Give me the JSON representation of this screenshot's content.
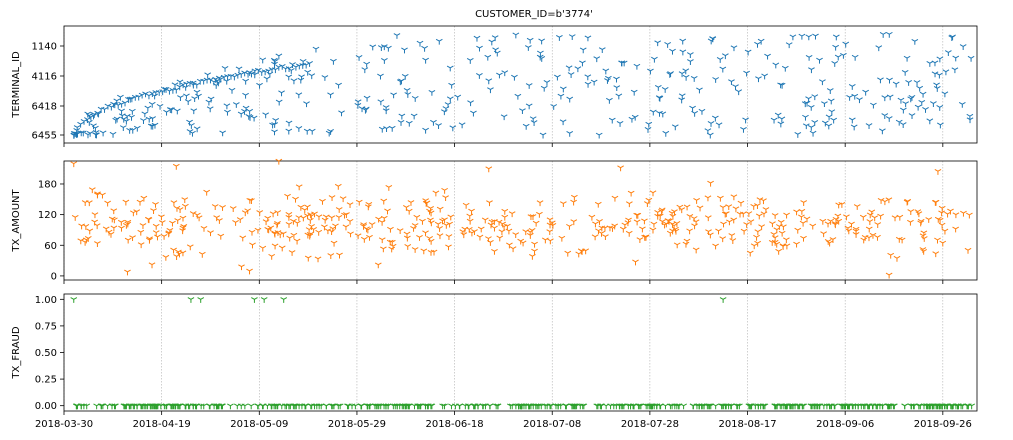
{
  "figure": {
    "title": "CUSTOMER_ID=b'3774'"
  },
  "x_axis": {
    "ticks": [
      "2018-03-30",
      "2018-04-19",
      "2018-05-09",
      "2018-05-29",
      "2018-06-18",
      "2018-07-08",
      "2018-07-28",
      "2018-08-17",
      "2018-09-06",
      "2018-09-26"
    ],
    "range": [
      "2018-03-30",
      "2018-10-03"
    ]
  },
  "colors": {
    "terminal": "#1f77b4",
    "amount": "#ff7f0e",
    "fraud": "#2ca02c",
    "grid": "#b0b0b0"
  },
  "chart_data": [
    {
      "type": "scatter",
      "marker": "tri-down",
      "ylabel": "TERMINAL_ID",
      "categorical_y": true,
      "y_tick_labels": [
        "1140",
        "4116",
        "6418",
        "6455"
      ],
      "grid": "x-only dotted",
      "points_sample": [
        {
          "x": "2018-04-01",
          "y": "6455"
        },
        {
          "x": "2018-04-06",
          "y": "6418"
        },
        {
          "x": "2018-04-12",
          "y": "4116"
        },
        {
          "x": "2018-04-24",
          "y": "4116"
        },
        {
          "x": "2018-05-10",
          "y": "1140"
        },
        {
          "x": "2018-06-03",
          "y": "1140"
        },
        {
          "x": "2018-06-28",
          "y": "6418"
        },
        {
          "x": "2018-07-19",
          "y": "1140"
        },
        {
          "x": "2018-08-05",
          "y": "1140"
        },
        {
          "x": "2018-09-02",
          "y": "1140"
        },
        {
          "x": "2018-09-30",
          "y": "6418"
        }
      ]
    },
    {
      "type": "scatter",
      "marker": "tri-down",
      "ylabel": "TX_AMOUNT",
      "y_ticks": [
        0,
        60,
        120,
        180
      ],
      "ylim": [
        -8,
        225
      ],
      "grid": "x-only dotted",
      "points_sample": [
        {
          "x": "2018-04-01",
          "y": 220
        },
        {
          "x": "2018-04-22",
          "y": 215
        },
        {
          "x": "2018-05-13",
          "y": 225
        },
        {
          "x": "2018-06-25",
          "y": 210
        },
        {
          "x": "2018-07-22",
          "y": 212
        },
        {
          "x": "2018-09-25",
          "y": 205
        },
        {
          "x": "2018-04-12",
          "y": 8
        },
        {
          "x": "2018-05-07",
          "y": 10
        },
        {
          "x": "2018-09-15",
          "y": 2
        }
      ]
    },
    {
      "type": "scatter",
      "marker": "tri-down",
      "ylabel": "TX_FRAUD",
      "y_ticks": [
        0.0,
        0.25,
        0.5,
        0.75,
        1.0
      ],
      "y_tick_labels": [
        "0.00",
        "0.25",
        "0.50",
        "0.75",
        "1.00"
      ],
      "ylim": [
        -0.05,
        1.05
      ],
      "grid": "x-only dotted",
      "fraud_points": [
        {
          "x": "2018-04-01",
          "y": 1
        },
        {
          "x": "2018-04-25",
          "y": 1
        },
        {
          "x": "2018-04-27",
          "y": 1
        },
        {
          "x": "2018-05-08",
          "y": 1
        },
        {
          "x": "2018-05-10",
          "y": 1
        },
        {
          "x": "2018-05-14",
          "y": 1
        },
        {
          "x": "2018-08-12",
          "y": 1
        }
      ],
      "non_fraud": {
        "y": 0,
        "x_range": [
          "2018-04-01",
          "2018-10-02"
        ]
      }
    }
  ]
}
